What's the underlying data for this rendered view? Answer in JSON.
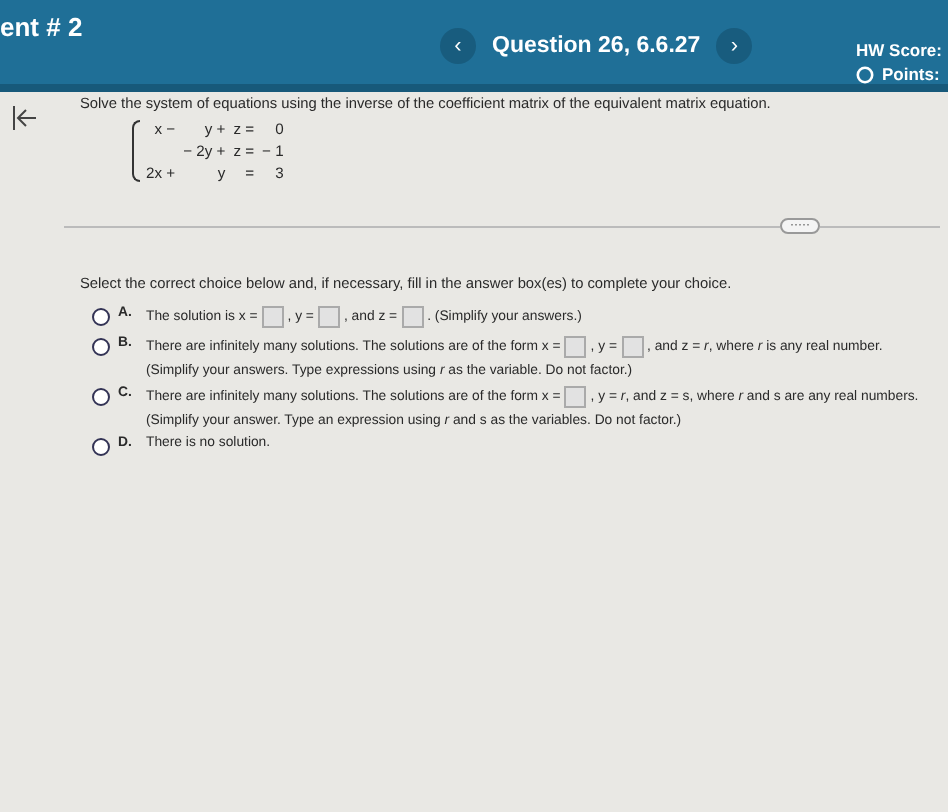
{
  "header": {
    "assignment": "ent # 2",
    "question": "Question 26, 6.6.27",
    "prev": "‹",
    "next": "›",
    "score": "HW Score:",
    "points": "Points:"
  },
  "prompt": "Solve the system of equations using the inverse of the coefficient matrix of the equivalent matrix equation.",
  "equations": [
    [
      "x −",
      "y +",
      "z =",
      "0"
    ],
    [
      "− 2y +",
      "z =",
      "− 1"
    ],
    [
      "2x +",
      "y",
      "=",
      "3"
    ]
  ],
  "more": "·····",
  "instruction": "Select the correct choice below and, if necessary, fill in the answer box(es) to complete your choice.",
  "choices": [
    {
      "label": "A.",
      "selected": false,
      "lines": [
        [
          {
            "kind": "text",
            "text": "The solution is x ="
          },
          {
            "kind": "box"
          },
          {
            "kind": "text",
            "text": ", y ="
          },
          {
            "kind": "box"
          },
          {
            "kind": "text",
            "text": ", and z ="
          },
          {
            "kind": "box"
          },
          {
            "kind": "text",
            "text": ". (Simplify your answers.)"
          }
        ]
      ]
    },
    {
      "label": "B.",
      "selected": false,
      "lines": [
        [
          {
            "kind": "text",
            "text": "There are infinitely many solutions. The solutions are of the form x ="
          },
          {
            "kind": "box"
          },
          {
            "kind": "text",
            "text": ", y ="
          },
          {
            "kind": "box"
          },
          {
            "kind": "text",
            "text": ", and z = *r*, where *r* is any real number."
          }
        ],
        [
          {
            "kind": "text",
            "text": "(Simplify your answers. Type expressions using *r* as the variable. Do not factor.)"
          }
        ]
      ]
    },
    {
      "label": "C.",
      "selected": false,
      "lines": [
        [
          {
            "kind": "text",
            "text": "There are infinitely many solutions. The solutions are of the form x ="
          },
          {
            "kind": "box"
          },
          {
            "kind": "text",
            "text": ", y = *r*, and z = s, where *r* and s are any real numbers."
          }
        ],
        [
          {
            "kind": "text",
            "text": "(Simplify your answer. Type an expression using *r* and s as the variables. Do not factor.)"
          }
        ]
      ]
    },
    {
      "label": "D.",
      "selected": false,
      "lines": [
        [
          {
            "kind": "text",
            "text": "There is no solution."
          }
        ]
      ]
    }
  ]
}
